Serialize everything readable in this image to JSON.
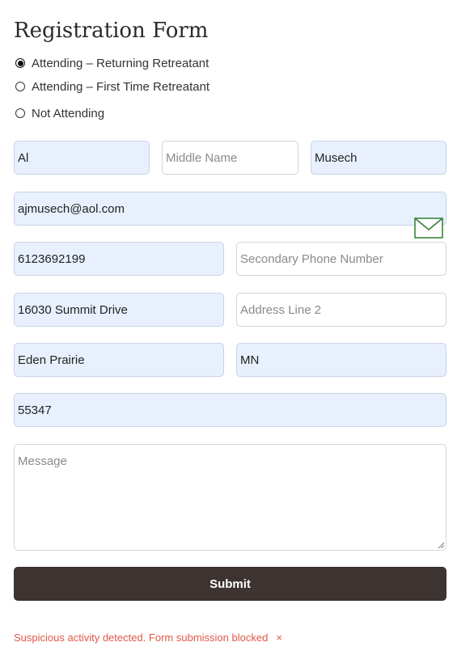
{
  "form": {
    "title": "Registration Form",
    "attendance_options": [
      {
        "label": "Attending – Returning Retreatant",
        "selected": true
      },
      {
        "label": "Attending – First Time Retreatant",
        "selected": false
      },
      {
        "label": "Not Attending",
        "selected": false
      }
    ],
    "first_name": {
      "value": "Al",
      "placeholder": ""
    },
    "middle_name": {
      "value": "",
      "placeholder": "Middle Name"
    },
    "last_name": {
      "value": "Musech",
      "placeholder": ""
    },
    "email": {
      "value": "ajmusech@aol.com",
      "placeholder": "",
      "icon": "mail-icon"
    },
    "phone": {
      "value": "6123692199",
      "placeholder": ""
    },
    "secondary_phone": {
      "value": "",
      "placeholder": "Secondary Phone Number"
    },
    "address1": {
      "value": "16030 Summit Drive",
      "placeholder": ""
    },
    "address2": {
      "value": "",
      "placeholder": "Address Line 2"
    },
    "city": {
      "value": "Eden Prairie",
      "placeholder": ""
    },
    "state": {
      "value": "MN",
      "placeholder": ""
    },
    "zip": {
      "value": "55347",
      "placeholder": ""
    },
    "message": {
      "value": "",
      "placeholder": "Message"
    },
    "submit_label": "Submit",
    "error_message": "Suspicious activity detected. Form submission blocked",
    "error_close": "×"
  },
  "colors": {
    "filled_field_bg": "#e8f0fe",
    "submit_bg": "#3d3330",
    "error_text": "#e0584a",
    "mail_icon": "#2e7d32"
  }
}
